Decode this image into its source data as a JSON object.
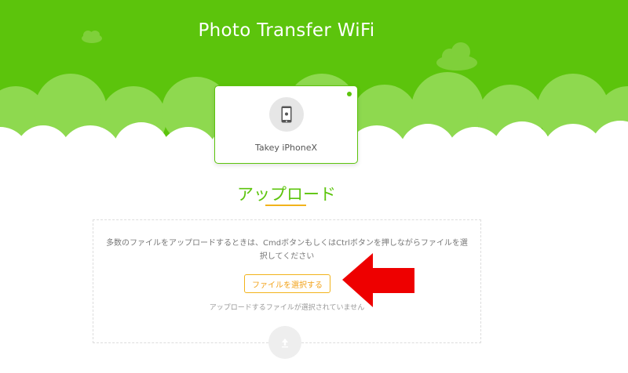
{
  "header": {
    "title": "Photo Transfer WiFi"
  },
  "device": {
    "name": "Takey iPhoneX",
    "icon": "iphone-icon",
    "status": "connected"
  },
  "upload": {
    "title": "アップロード",
    "hint": "多数のファイルをアップロードするときは、CmdボタンもしくはCtrlボタンを押しながらファイルを選択してください",
    "choose_file_label": "ファイルを選択する",
    "no_file_text": "アップロードするファイルが選択されていません",
    "upload_icon": "upload-arrow-icon"
  },
  "annotation": {
    "icon": "red-arrow-icon"
  },
  "colors": {
    "header_green": "#5cc40c",
    "accent_orange": "#f2b31b",
    "arrow_red": "#ee0000"
  }
}
